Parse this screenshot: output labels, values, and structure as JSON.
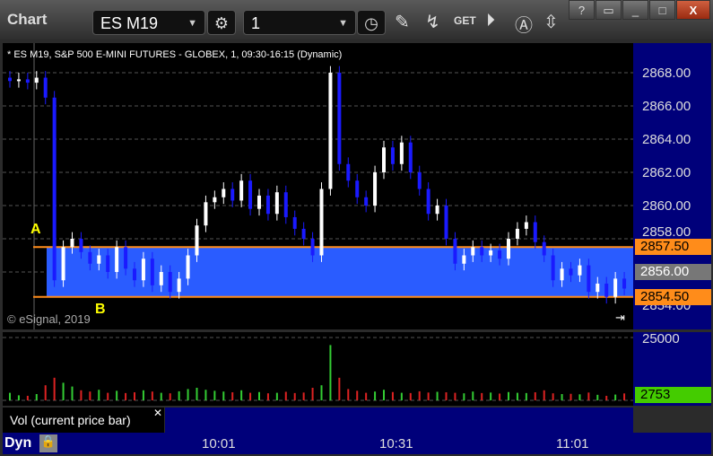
{
  "title": "Chart",
  "symbol": "ES M19",
  "interval": "1",
  "window_buttons": [
    "?",
    "▭",
    "_",
    "□",
    "X"
  ],
  "chart_header": "* ES M19, S&P 500 E-MINI FUTURES - GLOBEX, 1, 09:30-16:15 (Dynamic)",
  "copyright": "© eSignal, 2019",
  "markers": {
    "a": "A",
    "b": "B"
  },
  "price_labels": [
    "2868.00",
    "2866.00",
    "2864.00",
    "2862.00",
    "2860.00",
    "2858.00",
    "2854.00"
  ],
  "tags": {
    "upper": "2857.50",
    "mid": "2856.00",
    "lower": "2854.50"
  },
  "volume": {
    "label": "Vol (current price bar)",
    "axis_top": "25000",
    "axis_zero": "0",
    "current": "2753"
  },
  "time_labels": [
    "10:01",
    "10:31",
    "11:01"
  ],
  "footer": {
    "mode": "Dyn"
  },
  "colors": {
    "band": "#2a5cff",
    "level": "#ff8c1a",
    "up": "#ffffff",
    "down": "#1a1aff",
    "axis": "#00007a",
    "vol_up": "#33cc33",
    "vol_down": "#dd2222"
  },
  "chart_data": {
    "type": "candlestick",
    "ylim": [
      2853,
      2869
    ],
    "upper_level": 2857.5,
    "lower_level": 2854.5,
    "closes": [
      2867.5,
      2867.6,
      2867.4,
      2867.7,
      2866.5,
      2855.5,
      2857.5,
      2858,
      2857.2,
      2856.5,
      2857,
      2856,
      2857.5,
      2856.2,
      2855.5,
      2856.8,
      2855.2,
      2856,
      2854.8,
      2855.6,
      2857,
      2858.8,
      2860.2,
      2860.5,
      2861,
      2860.3,
      2861.5,
      2859.8,
      2860.6,
      2859.5,
      2860.8,
      2859.3,
      2858.6,
      2858,
      2857,
      2861,
      2868,
      2862.5,
      2861.5,
      2860.5,
      2860,
      2862,
      2863.5,
      2862.5,
      2863.8,
      2862,
      2861,
      2859.5,
      2860,
      2858,
      2856.5,
      2857,
      2857.5,
      2857,
      2857.3,
      2856.8,
      2858,
      2858.6,
      2859,
      2857.8,
      2857,
      2855.5,
      2856.2,
      2855.8,
      2856.4,
      2854.8,
      2855.3,
      2854.5,
      2855.6,
      2855
    ],
    "volumes": [
      3000,
      2000,
      1800,
      2500,
      6000,
      9000,
      7000,
      5500,
      4000,
      3500,
      4200,
      3000,
      3800,
      2900,
      3200,
      4000,
      3500,
      3000,
      2800,
      3600,
      4500,
      5000,
      4200,
      3800,
      3500,
      3200,
      4000,
      3000,
      3300,
      2800,
      3000,
      3400,
      2900,
      3100,
      5000,
      6000,
      22000,
      9000,
      4500,
      3800,
      3000,
      3500,
      4200,
      3300,
      3000,
      2900,
      3600,
      3100,
      3400,
      3200,
      3000,
      2800,
      3500,
      2900,
      3100,
      2700,
      3300,
      3000,
      2900,
      3200,
      4000,
      2800,
      2500,
      2600,
      2400,
      3100,
      2200,
      1800,
      2300,
      2753
    ],
    "vol_ylim": [
      0,
      25000
    ]
  }
}
